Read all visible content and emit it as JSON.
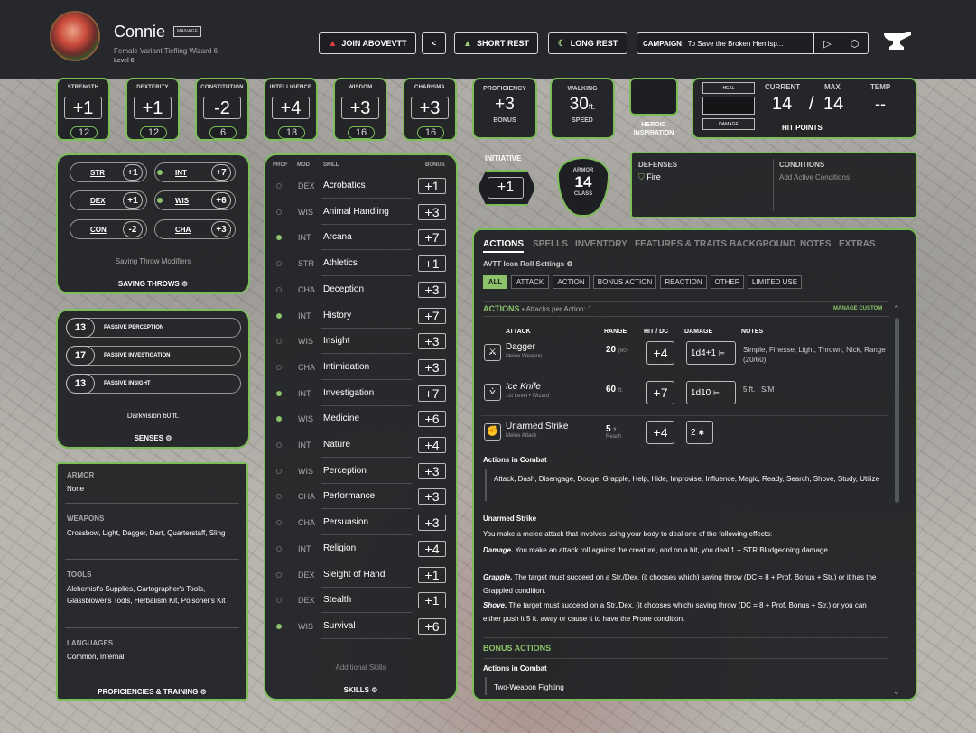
{
  "header": {
    "name": "Connie",
    "manage_label": "MANAGE",
    "subtitle": "Female  Variant Tiefling  Wizard 6",
    "level": "Level 6",
    "join_label": "JOIN ABOVEVTT",
    "short_rest_label": "SHORT REST",
    "long_rest_label": "LONG REST",
    "campaign_label": "CAMPAIGN:",
    "campaign_value": "To Save the Broken Hemisp..."
  },
  "abilities": [
    {
      "name": "STRENGTH",
      "mod": "+1",
      "score": "12"
    },
    {
      "name": "DEXTERITY",
      "mod": "+1",
      "score": "12"
    },
    {
      "name": "CONSTITUTION",
      "mod": "-2",
      "score": "6"
    },
    {
      "name": "INTELLIGENCE",
      "mod": "+4",
      "score": "18"
    },
    {
      "name": "WISDOM",
      "mod": "+3",
      "score": "16"
    },
    {
      "name": "CHARISMA",
      "mod": "+3",
      "score": "16"
    }
  ],
  "proficiency": {
    "title": "PROFICIENCY",
    "value": "+3",
    "label": "BONUS"
  },
  "walking": {
    "title": "WALKING",
    "value": "30",
    "unit": "ft.",
    "label": "SPEED"
  },
  "heroic": {
    "label1": "HEROIC",
    "label2": "INSPIRATION"
  },
  "hp": {
    "heal_label": "HEAL",
    "damage_label": "DAMAGE",
    "current_label": "CURRENT",
    "max_label": "MAX",
    "temp_label": "TEMP",
    "current": "14",
    "sep": "/",
    "max": "14",
    "temp": "--",
    "title": "HIT POINTS"
  },
  "initiative": {
    "label": "INITIATIVE",
    "value": "+1"
  },
  "armor": {
    "top": "ARMOR",
    "value": "14",
    "bottom": "CLASS"
  },
  "defenses": {
    "title": "DEFENSES",
    "value": "Fire"
  },
  "conditions": {
    "title": "CONDITIONS",
    "value": "Add Active Conditions"
  },
  "saving_throws": {
    "items": [
      {
        "name": "STR",
        "value": "+1",
        "prof": false
      },
      {
        "name": "INT",
        "value": "+7",
        "prof": true
      },
      {
        "name": "DEX",
        "value": "+1",
        "prof": false
      },
      {
        "name": "WIS",
        "value": "+6",
        "prof": true
      },
      {
        "name": "CON",
        "value": "-2",
        "prof": false
      },
      {
        "name": "CHA",
        "value": "+3",
        "prof": false
      }
    ],
    "modifiers_label": "Saving Throw Modifiers",
    "title": "SAVING THROWS"
  },
  "senses": {
    "items": [
      {
        "value": "13",
        "name": "PASSIVE PERCEPTION"
      },
      {
        "value": "17",
        "name": "PASSIVE INVESTIGATION"
      },
      {
        "value": "13",
        "name": "PASSIVE INSIGHT"
      }
    ],
    "darkvision": "Darkvision 60 ft.",
    "title": "SENSES"
  },
  "proficiencies": {
    "armor_h": "ARMOR",
    "armor_v": "None",
    "weapons_h": "WEAPONS",
    "weapons_v": "Crossbow, Light, Dagger, Dart, Quarterstaff, Sling",
    "tools_h": "TOOLS",
    "tools_v": "Alchemist's Supplies, Cartographer's Tools, Glassblower's Tools, Herbalism Kit, Poisoner's Kit",
    "languages_h": "LANGUAGES",
    "languages_v": "Common, Infernal",
    "title": "PROFICIENCIES & TRAINING"
  },
  "skills": {
    "headers": {
      "prof": "PROF",
      "mod": "MOD",
      "skill": "SKILL",
      "bonus": "BONUS"
    },
    "items": [
      {
        "ab": "DEX",
        "name": "Acrobatics",
        "bonus": "+1",
        "prof": false
      },
      {
        "ab": "WIS",
        "name": "Animal Handling",
        "bonus": "+3",
        "prof": false
      },
      {
        "ab": "INT",
        "name": "Arcana",
        "bonus": "+7",
        "prof": true
      },
      {
        "ab": "STR",
        "name": "Athletics",
        "bonus": "+1",
        "prof": false
      },
      {
        "ab": "CHA",
        "name": "Deception",
        "bonus": "+3",
        "prof": false
      },
      {
        "ab": "INT",
        "name": "History",
        "bonus": "+7",
        "prof": true
      },
      {
        "ab": "WIS",
        "name": "Insight",
        "bonus": "+3",
        "prof": false
      },
      {
        "ab": "CHA",
        "name": "Intimidation",
        "bonus": "+3",
        "prof": false
      },
      {
        "ab": "INT",
        "name": "Investigation",
        "bonus": "+7",
        "prof": true
      },
      {
        "ab": "WIS",
        "name": "Medicine",
        "bonus": "+6",
        "prof": true
      },
      {
        "ab": "INT",
        "name": "Nature",
        "bonus": "+4",
        "prof": false
      },
      {
        "ab": "WIS",
        "name": "Perception",
        "bonus": "+3",
        "prof": false
      },
      {
        "ab": "CHA",
        "name": "Performance",
        "bonus": "+3",
        "prof": false
      },
      {
        "ab": "CHA",
        "name": "Persuasion",
        "bonus": "+3",
        "prof": false
      },
      {
        "ab": "INT",
        "name": "Religion",
        "bonus": "+4",
        "prof": false
      },
      {
        "ab": "DEX",
        "name": "Sleight of Hand",
        "bonus": "+1",
        "prof": false
      },
      {
        "ab": "DEX",
        "name": "Stealth",
        "bonus": "+1",
        "prof": false
      },
      {
        "ab": "WIS",
        "name": "Survival",
        "bonus": "+6",
        "prof": true
      }
    ],
    "additional": "Additional Skills",
    "title": "SKILLS"
  },
  "actions_panel": {
    "tabs": [
      "ACTIONS",
      "SPELLS",
      "INVENTORY",
      "FEATURES & TRAITS",
      "BACKGROUND",
      "NOTES",
      "EXTRAS"
    ],
    "roll_settings": "AVTT Icon Roll Settings",
    "filters": [
      "ALL",
      "ATTACK",
      "ACTION",
      "BONUS ACTION",
      "REACTION",
      "OTHER",
      "LIMITED USE"
    ],
    "section_title": "ACTIONS",
    "attacks_per_action": "• Attacks per Action: 1",
    "manage_custom": "MANAGE CUSTOM",
    "columns": {
      "attack": "ATTACK",
      "range": "RANGE",
      "hit": "HIT / DC",
      "damage": "DAMAGE",
      "notes": "NOTES"
    },
    "attacks": [
      {
        "name": "Dagger",
        "sub": "Melee Weapon",
        "range": "20",
        "range_sub": "(60)",
        "hit": "+4",
        "damage": "1d4+1",
        "notes": "Simple, Finesse, Light, Thrown, Nick, Range (20/60)"
      },
      {
        "name": "Ice Knife",
        "sub": "1st Level • Wizard",
        "range": "60",
        "range_sub": "ft.",
        "hit": "+7",
        "damage": "1d10",
        "notes": "5 ft.    , S/M"
      },
      {
        "name": "Unarmed Strike",
        "sub": "Melee Attack",
        "range": "5",
        "range_sub": "ft.",
        "range_sub2": "Reach",
        "hit": "+4",
        "damage": "2",
        "notes": ""
      }
    ],
    "combat_title": "Actions in Combat",
    "combat_list": "Attack, Dash, Disengage, Dodge, Grapple, Help, Hide, Improvise, Influence, Magic, Ready, Search, Shove, Study, Utilize",
    "unarmed_title": "Unarmed Strike",
    "unarmed_intro": "You make a melee attack that involves using your body to deal one of the following effects:",
    "damage_label": "Damage.",
    "damage_text": " You make an attack roll against the creature, and on a hit, you deal 1 + STR Bludgeoning damage.",
    "grapple_label": "Grapple.",
    "grapple_text": " The target must succeed on a Str./Dex. (it chooses which) saving throw (DC = 8 + Prof. Bonus + Str.) or it has the Grappled condition.",
    "shove_label": "Shove.",
    "shove_text": " The target must succeed on a Str./Dex. (it chooses which) saving throw (DC = 8 + Prof. Bonus + Str.) or you can either push it 5 ft. away or cause it to have the Prone condition.",
    "bonus_title": "BONUS ACTIONS",
    "bonus_combat_title": "Actions in Combat",
    "bonus_item": "Two-Weapon Fighting"
  },
  "colors": {
    "accent": "#7cbd5a",
    "panel": "#1d1f22",
    "header": "#26282b"
  }
}
